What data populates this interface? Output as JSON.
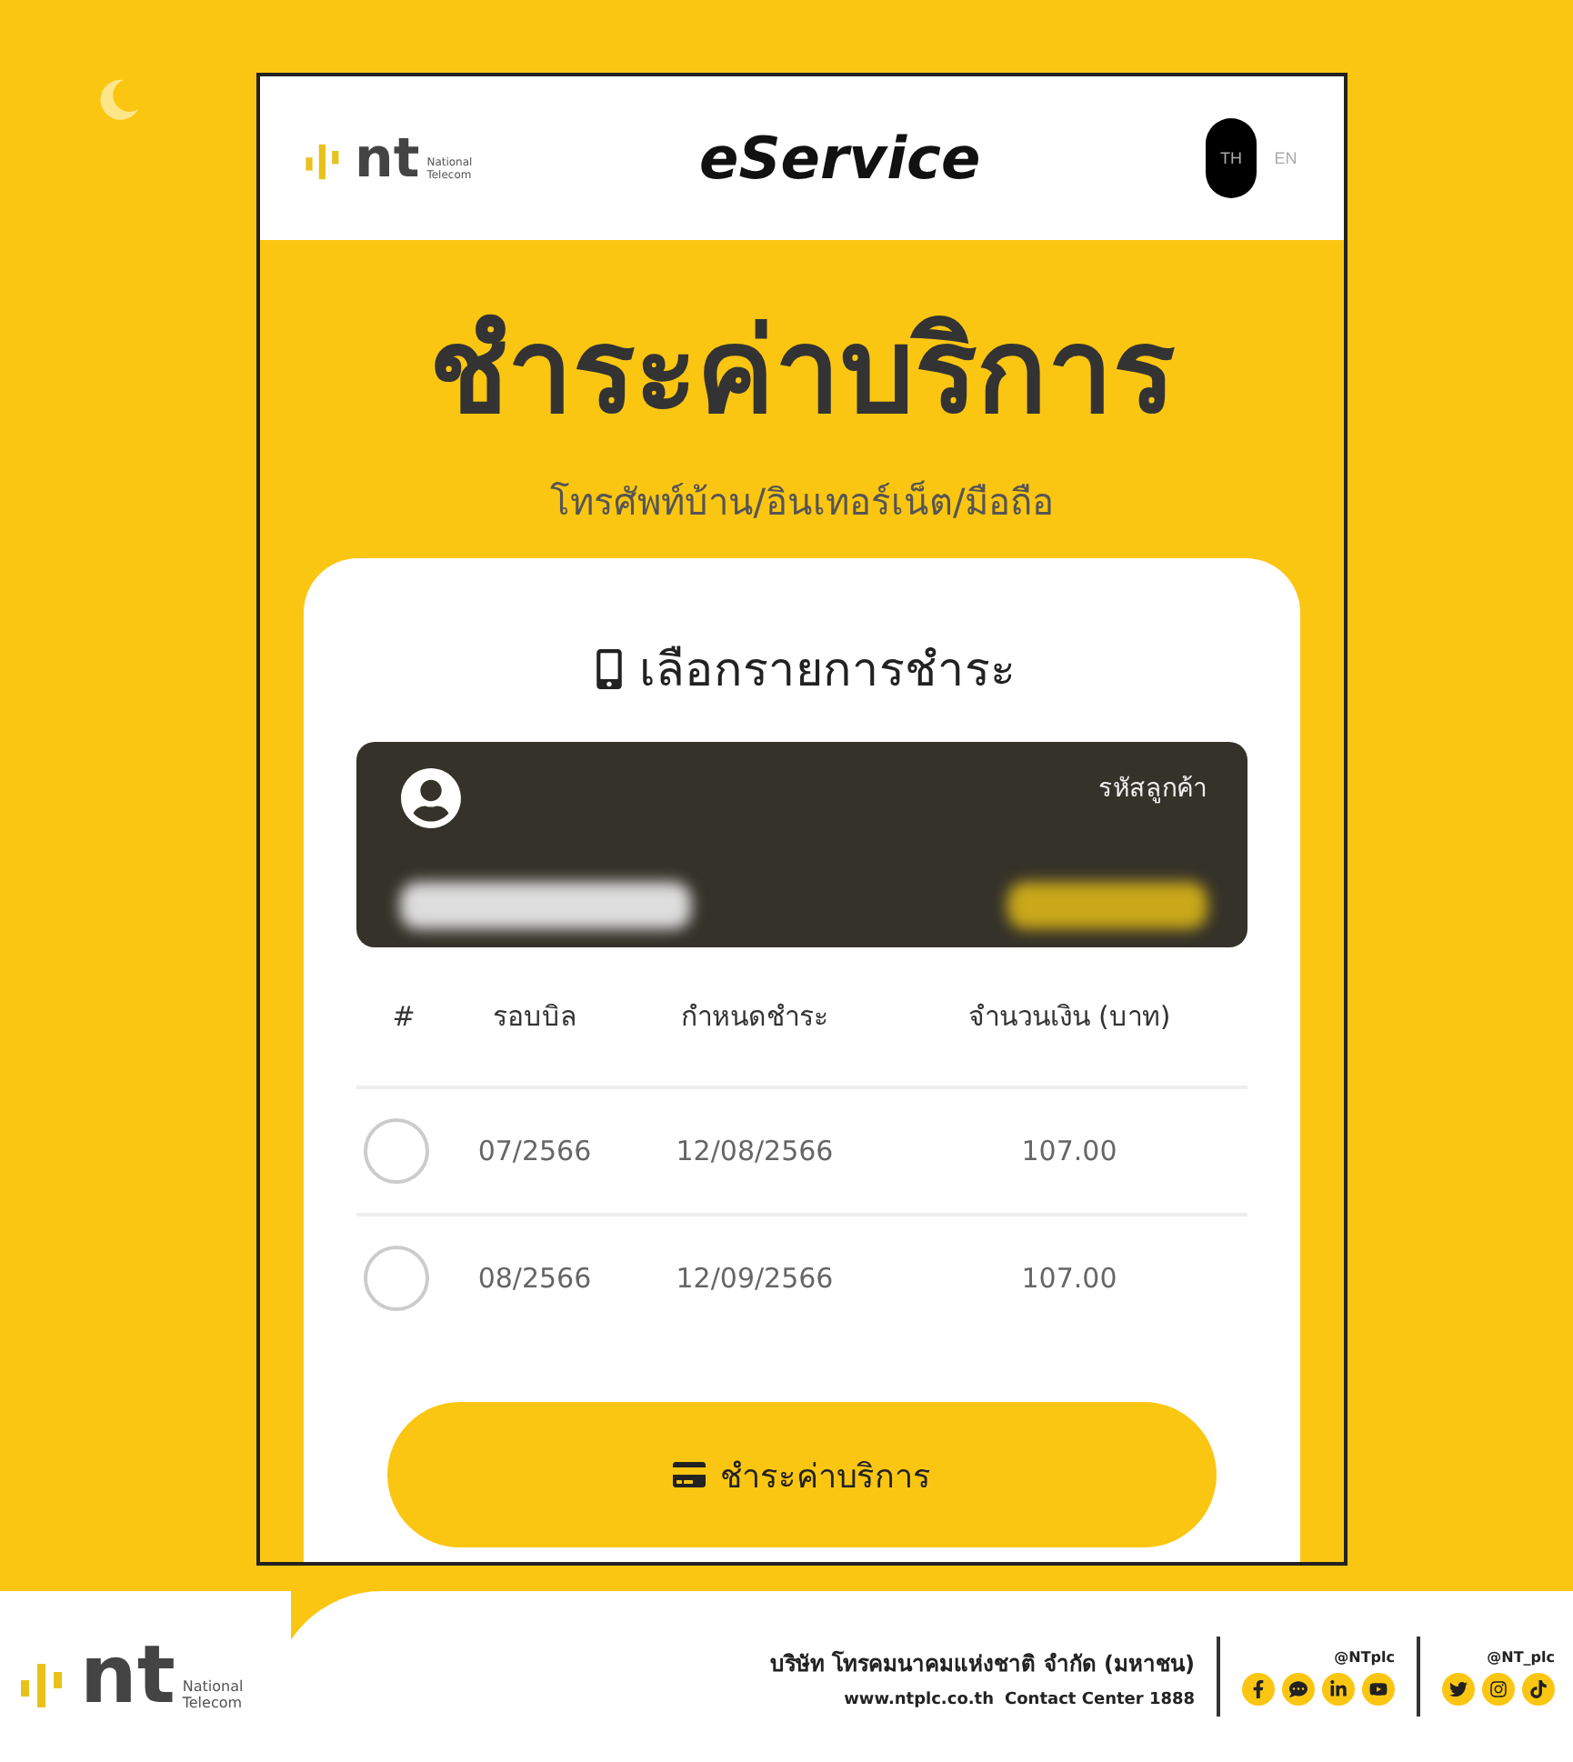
{
  "header": {
    "logo": {
      "mark": "nt",
      "tagline": "National Telecom"
    },
    "title": "eService",
    "languages": [
      {
        "label": "TH",
        "selected": true
      },
      {
        "label": "EN",
        "selected": false
      }
    ]
  },
  "hero": {
    "title": "ชำระค่าบริการ",
    "subtitle": "โทรศัพท์บ้าน/อินเทอร์เน็ต/มือถือ"
  },
  "card": {
    "heading": "เลือกรายการชำระ",
    "customer": {
      "code_label": "รหัสลูกค้า"
    },
    "table": {
      "columns": [
        "#",
        "รอบบิล",
        "กำหนดชำระ",
        "จำนวนเงิน (บาท)"
      ],
      "rows": [
        {
          "selected": false,
          "billing_cycle": "07/2566",
          "due_date": "12/08/2566",
          "amount": "107.00"
        },
        {
          "selected": false,
          "billing_cycle": "08/2566",
          "due_date": "12/09/2566",
          "amount": "107.00"
        }
      ]
    },
    "pay_button": "ชำระค่าบริการ"
  },
  "footer": {
    "logo": {
      "mark": "nt",
      "tagline": "National Telecom"
    },
    "company": "บริษัท โทรคมนาคมแห่งชาติ จำกัด (มหาชน)",
    "website": "www.ntplc.co.th",
    "contact": "Contact Center 1888",
    "social_groups": [
      {
        "handle": "@NTplc"
      },
      {
        "handle": "@NT_plc"
      }
    ]
  }
}
